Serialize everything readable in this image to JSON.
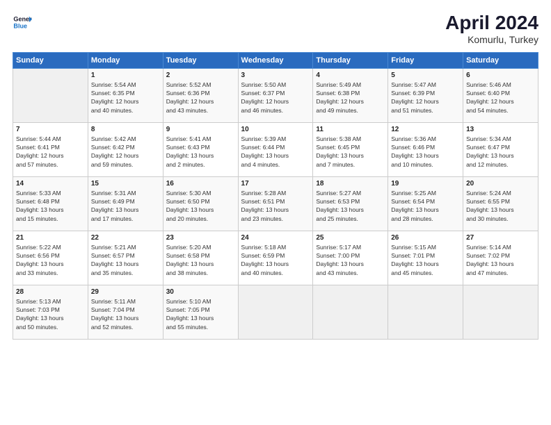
{
  "header": {
    "logo_line1": "General",
    "logo_line2": "Blue",
    "title": "April 2024",
    "subtitle": "Komurlu, Turkey"
  },
  "days_of_week": [
    "Sunday",
    "Monday",
    "Tuesday",
    "Wednesday",
    "Thursday",
    "Friday",
    "Saturday"
  ],
  "weeks": [
    [
      {
        "day": "",
        "data": ""
      },
      {
        "day": "1",
        "data": "Sunrise: 5:54 AM\nSunset: 6:35 PM\nDaylight: 12 hours\nand 40 minutes."
      },
      {
        "day": "2",
        "data": "Sunrise: 5:52 AM\nSunset: 6:36 PM\nDaylight: 12 hours\nand 43 minutes."
      },
      {
        "day": "3",
        "data": "Sunrise: 5:50 AM\nSunset: 6:37 PM\nDaylight: 12 hours\nand 46 minutes."
      },
      {
        "day": "4",
        "data": "Sunrise: 5:49 AM\nSunset: 6:38 PM\nDaylight: 12 hours\nand 49 minutes."
      },
      {
        "day": "5",
        "data": "Sunrise: 5:47 AM\nSunset: 6:39 PM\nDaylight: 12 hours\nand 51 minutes."
      },
      {
        "day": "6",
        "data": "Sunrise: 5:46 AM\nSunset: 6:40 PM\nDaylight: 12 hours\nand 54 minutes."
      }
    ],
    [
      {
        "day": "7",
        "data": "Sunrise: 5:44 AM\nSunset: 6:41 PM\nDaylight: 12 hours\nand 57 minutes."
      },
      {
        "day": "8",
        "data": "Sunrise: 5:42 AM\nSunset: 6:42 PM\nDaylight: 12 hours\nand 59 minutes."
      },
      {
        "day": "9",
        "data": "Sunrise: 5:41 AM\nSunset: 6:43 PM\nDaylight: 13 hours\nand 2 minutes."
      },
      {
        "day": "10",
        "data": "Sunrise: 5:39 AM\nSunset: 6:44 PM\nDaylight: 13 hours\nand 4 minutes."
      },
      {
        "day": "11",
        "data": "Sunrise: 5:38 AM\nSunset: 6:45 PM\nDaylight: 13 hours\nand 7 minutes."
      },
      {
        "day": "12",
        "data": "Sunrise: 5:36 AM\nSunset: 6:46 PM\nDaylight: 13 hours\nand 10 minutes."
      },
      {
        "day": "13",
        "data": "Sunrise: 5:34 AM\nSunset: 6:47 PM\nDaylight: 13 hours\nand 12 minutes."
      }
    ],
    [
      {
        "day": "14",
        "data": "Sunrise: 5:33 AM\nSunset: 6:48 PM\nDaylight: 13 hours\nand 15 minutes."
      },
      {
        "day": "15",
        "data": "Sunrise: 5:31 AM\nSunset: 6:49 PM\nDaylight: 13 hours\nand 17 minutes."
      },
      {
        "day": "16",
        "data": "Sunrise: 5:30 AM\nSunset: 6:50 PM\nDaylight: 13 hours\nand 20 minutes."
      },
      {
        "day": "17",
        "data": "Sunrise: 5:28 AM\nSunset: 6:51 PM\nDaylight: 13 hours\nand 23 minutes."
      },
      {
        "day": "18",
        "data": "Sunrise: 5:27 AM\nSunset: 6:53 PM\nDaylight: 13 hours\nand 25 minutes."
      },
      {
        "day": "19",
        "data": "Sunrise: 5:25 AM\nSunset: 6:54 PM\nDaylight: 13 hours\nand 28 minutes."
      },
      {
        "day": "20",
        "data": "Sunrise: 5:24 AM\nSunset: 6:55 PM\nDaylight: 13 hours\nand 30 minutes."
      }
    ],
    [
      {
        "day": "21",
        "data": "Sunrise: 5:22 AM\nSunset: 6:56 PM\nDaylight: 13 hours\nand 33 minutes."
      },
      {
        "day": "22",
        "data": "Sunrise: 5:21 AM\nSunset: 6:57 PM\nDaylight: 13 hours\nand 35 minutes."
      },
      {
        "day": "23",
        "data": "Sunrise: 5:20 AM\nSunset: 6:58 PM\nDaylight: 13 hours\nand 38 minutes."
      },
      {
        "day": "24",
        "data": "Sunrise: 5:18 AM\nSunset: 6:59 PM\nDaylight: 13 hours\nand 40 minutes."
      },
      {
        "day": "25",
        "data": "Sunrise: 5:17 AM\nSunset: 7:00 PM\nDaylight: 13 hours\nand 43 minutes."
      },
      {
        "day": "26",
        "data": "Sunrise: 5:15 AM\nSunset: 7:01 PM\nDaylight: 13 hours\nand 45 minutes."
      },
      {
        "day": "27",
        "data": "Sunrise: 5:14 AM\nSunset: 7:02 PM\nDaylight: 13 hours\nand 47 minutes."
      }
    ],
    [
      {
        "day": "28",
        "data": "Sunrise: 5:13 AM\nSunset: 7:03 PM\nDaylight: 13 hours\nand 50 minutes."
      },
      {
        "day": "29",
        "data": "Sunrise: 5:11 AM\nSunset: 7:04 PM\nDaylight: 13 hours\nand 52 minutes."
      },
      {
        "day": "30",
        "data": "Sunrise: 5:10 AM\nSunset: 7:05 PM\nDaylight: 13 hours\nand 55 minutes."
      },
      {
        "day": "",
        "data": ""
      },
      {
        "day": "",
        "data": ""
      },
      {
        "day": "",
        "data": ""
      },
      {
        "day": "",
        "data": ""
      }
    ]
  ]
}
